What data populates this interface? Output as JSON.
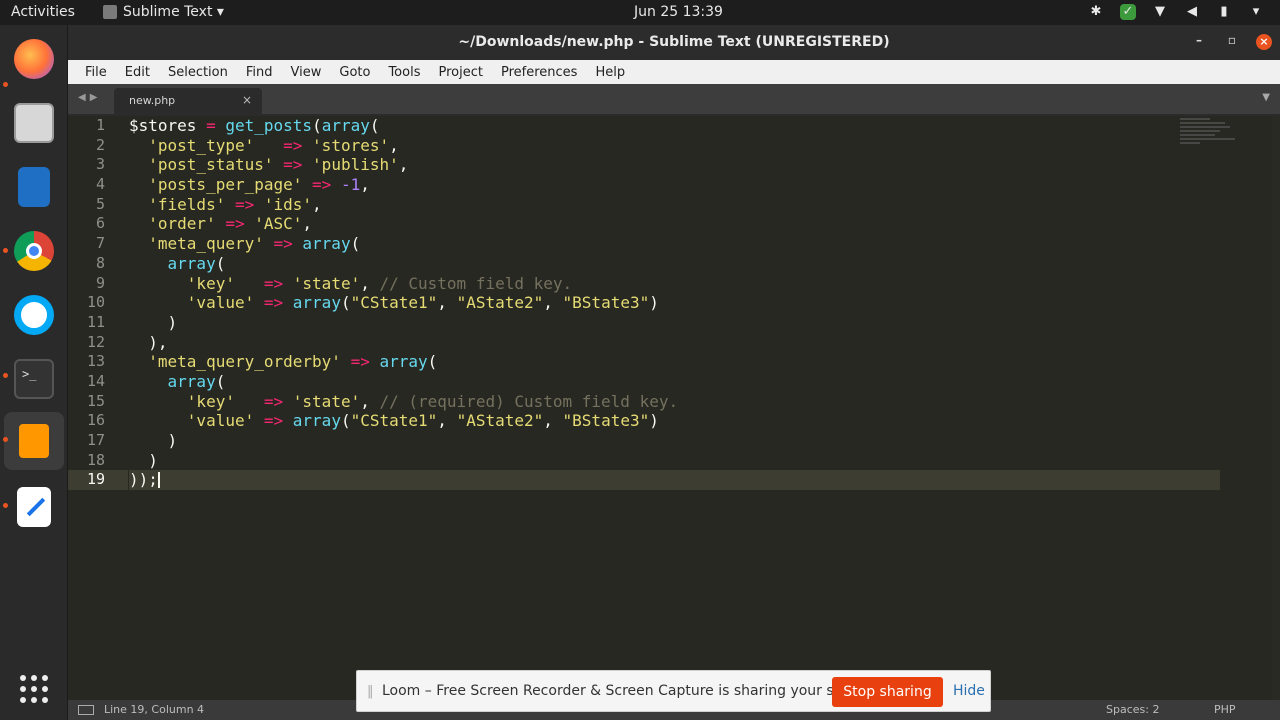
{
  "topbar": {
    "activities": "Activities",
    "app_menu": "Sublime Text ▾",
    "clock": "Jun 25  13:39"
  },
  "window": {
    "title": "~/Downloads/new.php - Sublime Text (UNREGISTERED)",
    "menu": [
      "File",
      "Edit",
      "Selection",
      "Find",
      "View",
      "Goto",
      "Tools",
      "Project",
      "Preferences",
      "Help"
    ]
  },
  "tabs": [
    {
      "name": "new.php",
      "active": true
    }
  ],
  "editor": {
    "current_line": 19,
    "lines": [
      "$stores = get_posts(array(",
      "  'post_type'   => 'stores',",
      "  'post_status' => 'publish',",
      "  'posts_per_page' => -1,",
      "  'fields' => 'ids',",
      "  'order' => 'ASC',",
      "  'meta_query' => array(",
      "    array(",
      "      'key'   => 'state', // Custom field key.",
      "      'value' => array(\"CState1\", \"AState2\", \"BState3\")",
      "    )",
      "  ),",
      "  'meta_query_orderby' => array(",
      "    array(",
      "      'key'   => 'state', // (required) Custom field key.",
      "      'value' => array(\"CState1\", \"AState2\", \"BState3\")",
      "    )",
      "  )",
      "));"
    ]
  },
  "statusbar": {
    "position": "Line 19, Column 4",
    "spaces": "Spaces: 2",
    "syntax": "PHP"
  },
  "loom": {
    "message": "Loom – Free Screen Recorder & Screen Capture is sharing your screen.",
    "stop": "Stop sharing",
    "hide": "Hide"
  },
  "dock": [
    "firefox-icon",
    "files-icon",
    "writer-icon",
    "chrome-icon",
    "clockify-icon",
    "terminal-icon",
    "sublime-text-icon",
    "text-editor-icon",
    "show-apps-icon"
  ],
  "colors": {
    "accent": "#e95420",
    "loom_stop": "#e8400e",
    "editor_bg": "#272822"
  }
}
